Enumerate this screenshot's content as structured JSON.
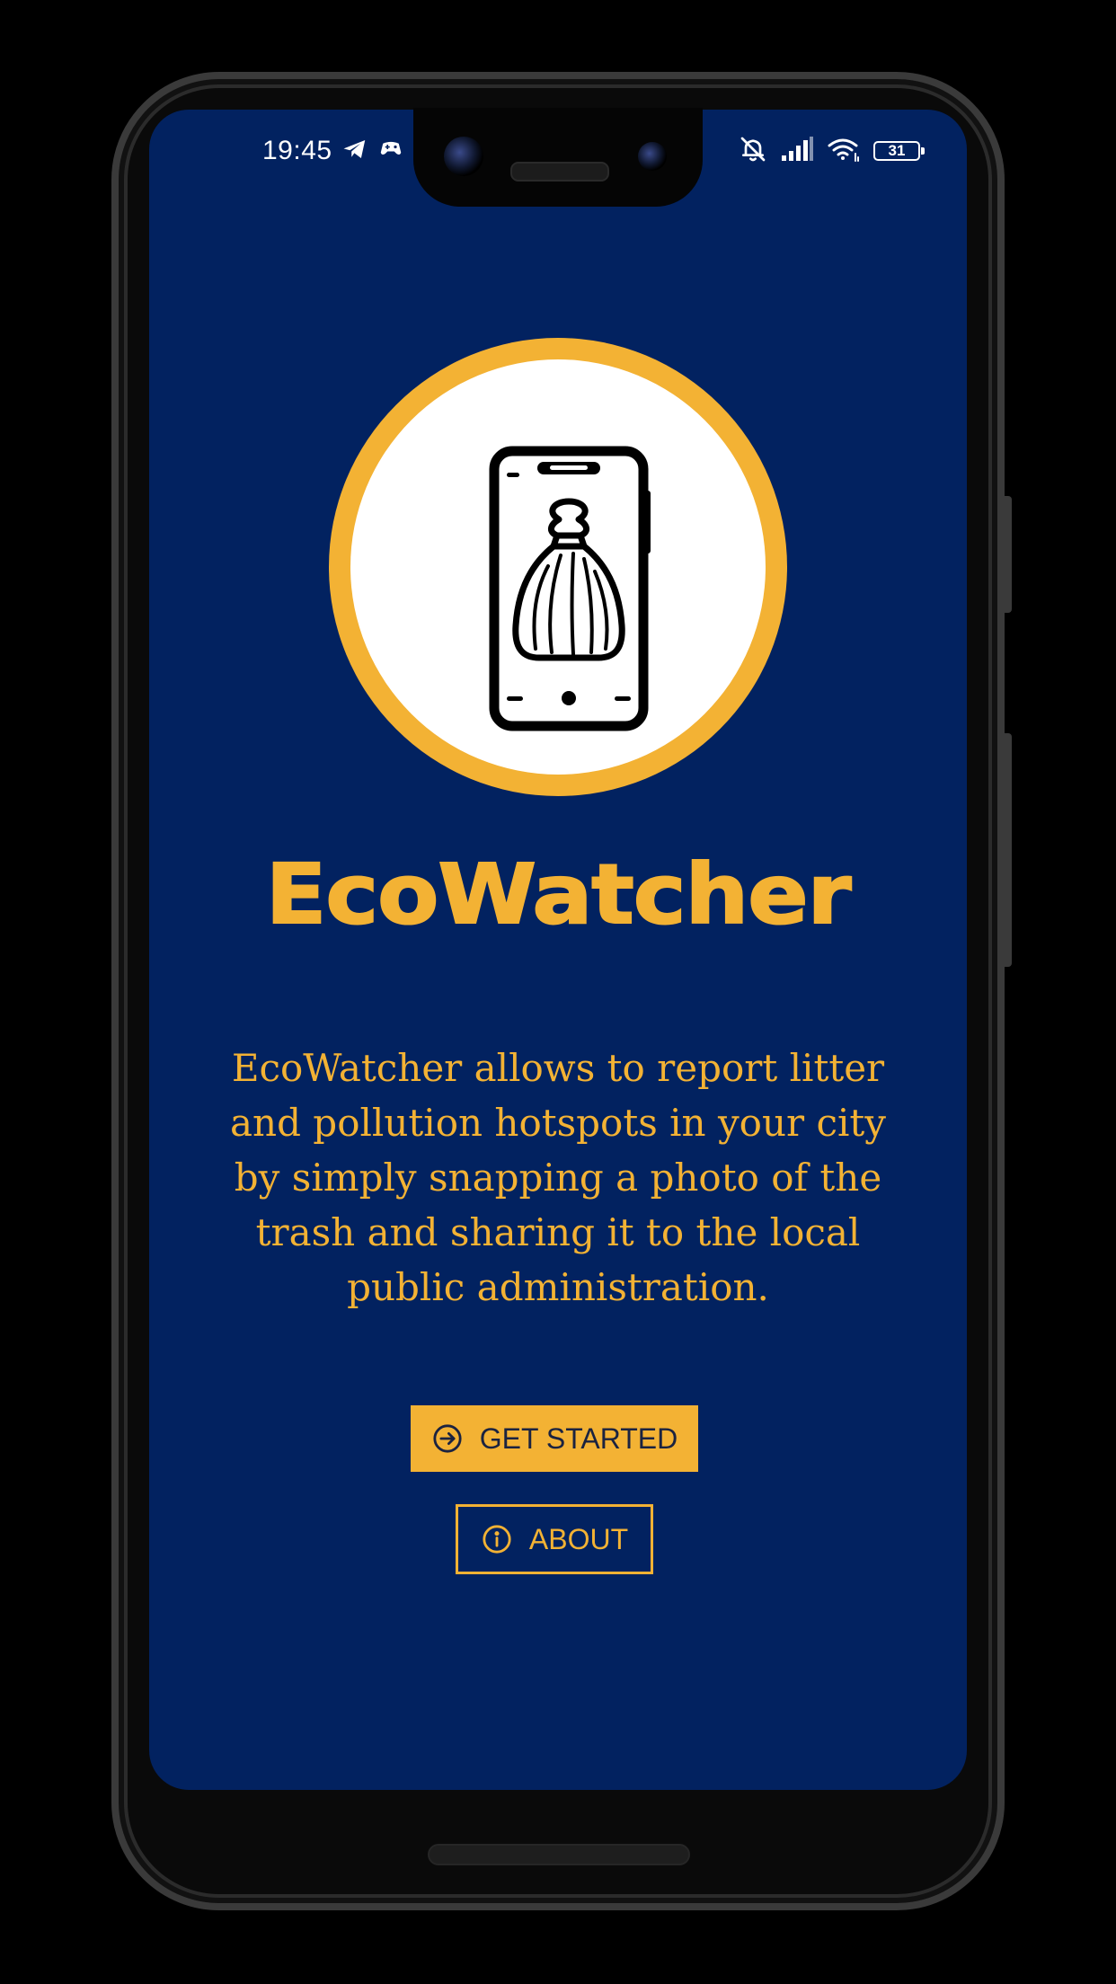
{
  "status_bar": {
    "time": "19:45",
    "battery": "31"
  },
  "app": {
    "title": "EcoWatcher",
    "description": "EcoWatcher allows to report litter and pollution hotspots in your city by simply snapping a photo of the trash and sharing it to the local public administration."
  },
  "buttons": {
    "get_started": "GET STARTED",
    "about": "ABOUT"
  },
  "colors": {
    "background": "#022260",
    "accent": "#f3b234",
    "primary_button_text": "#1b2340"
  },
  "icons": {
    "logo": "phone-with-trash-bag-icon",
    "get_started": "arrow-circle-right-icon",
    "about": "info-circle-icon"
  }
}
